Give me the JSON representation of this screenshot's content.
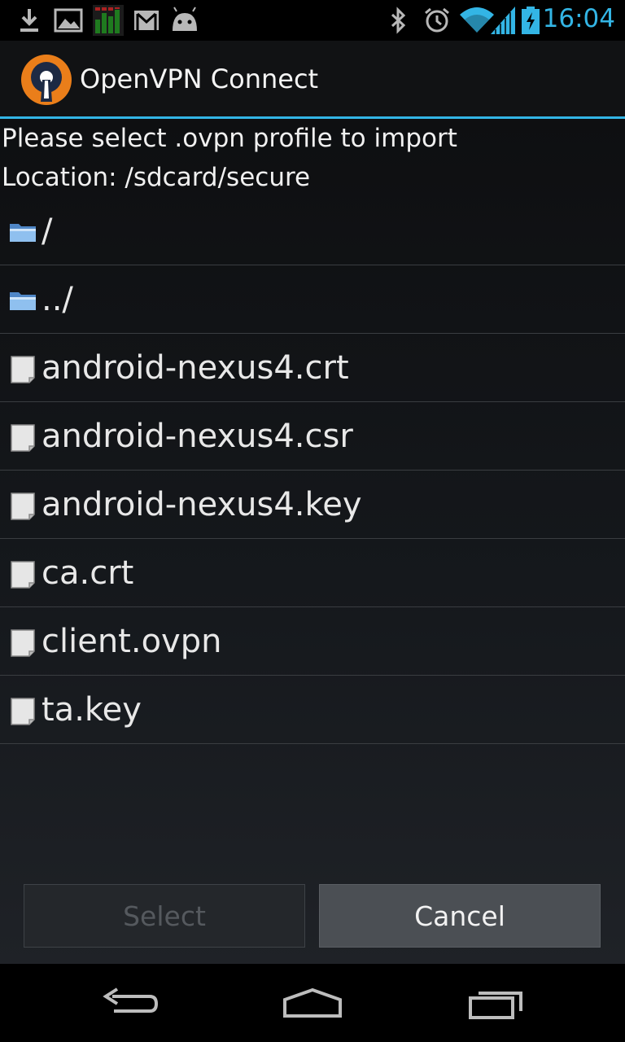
{
  "status_bar": {
    "time": "16:04",
    "left_icons": [
      "download-icon",
      "image-icon",
      "equalizer-icon",
      "gmail-icon",
      "android-icon"
    ],
    "right_icons": [
      "bluetooth-icon",
      "alarm-icon",
      "wifi-icon",
      "signal-icon",
      "battery-charging-icon"
    ],
    "accent_color": "#33b5e5"
  },
  "action_bar": {
    "title": "OpenVPN Connect",
    "logo_icon": "openvpn-logo-icon",
    "divider_color": "#33b5e5"
  },
  "dialog": {
    "prompt": "Please select .ovpn profile to import",
    "location": "Location: /sdcard/secure",
    "items": [
      {
        "label": "/",
        "icon": "folder-icon"
      },
      {
        "label": "../",
        "icon": "folder-icon"
      },
      {
        "label": "android-nexus4.crt",
        "icon": "file-icon"
      },
      {
        "label": "android-nexus4.csr",
        "icon": "file-icon"
      },
      {
        "label": "android-nexus4.key",
        "icon": "file-icon"
      },
      {
        "label": "ca.crt",
        "icon": "file-icon"
      },
      {
        "label": "client.ovpn",
        "icon": "file-icon"
      },
      {
        "label": "ta.key",
        "icon": "file-icon"
      }
    ],
    "select_label": "Select",
    "cancel_label": "Cancel",
    "select_enabled": false
  },
  "nav_bar": {
    "buttons": [
      "back-icon",
      "home-icon",
      "recent-apps-icon"
    ]
  }
}
